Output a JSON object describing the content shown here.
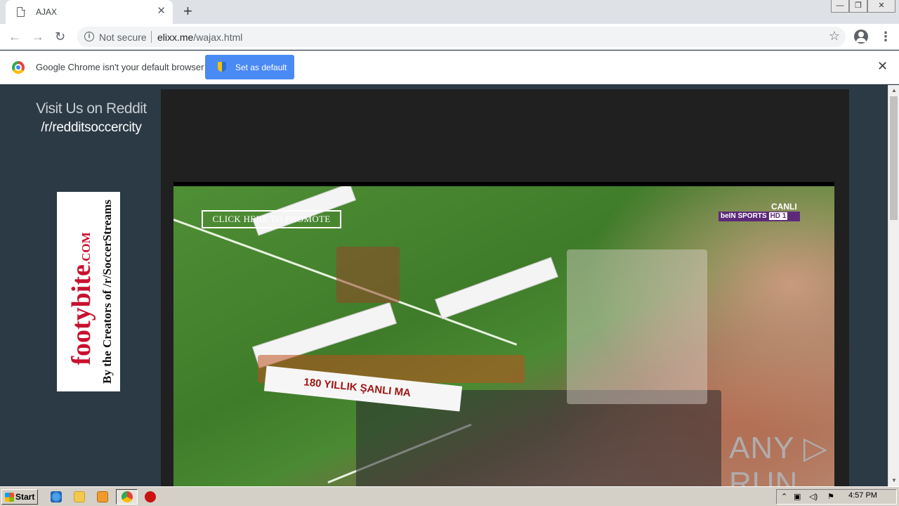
{
  "browser": {
    "tab": {
      "title": "AJAX",
      "close_glyph": "✕"
    },
    "new_tab_glyph": "+",
    "window_controls": {
      "minimize": "—",
      "restore": "❐",
      "close": "✕"
    },
    "nav": {
      "back": "←",
      "forward": "→",
      "reload": "↻"
    },
    "omnibox": {
      "security": "Not secure",
      "host": "elixx.me",
      "path": "/wajax.html",
      "star": "☆"
    },
    "menu_glyph": "⋮"
  },
  "infobar": {
    "message": "Google Chrome isn't your default browser",
    "button": "Set as default",
    "close": "✕"
  },
  "page": {
    "reddit_title": "Visit Us on Reddit",
    "reddit_sub": "/r/redditsoccercity",
    "banner_brand": "footybite",
    "banner_brand_suffix": ".COM",
    "banner_tagline": "By the Creators of /r/SoccerStreams",
    "player": {
      "overlay_button": "CLICK HERE TO PROMOTE",
      "live_label": "CANLI",
      "channel": "beIN SPORTS",
      "channel_hd": "HD 1",
      "banner_text": "180 YILLIK ŞANLI MA"
    }
  },
  "watermark": "ANY ▷ RUN",
  "scrollbar": {
    "up": "▲",
    "down": "▼"
  },
  "taskbar": {
    "start": "Start",
    "tray_icons": [
      "⌃",
      "▣",
      "◁)",
      "⚑"
    ],
    "time": "4:57 PM"
  }
}
